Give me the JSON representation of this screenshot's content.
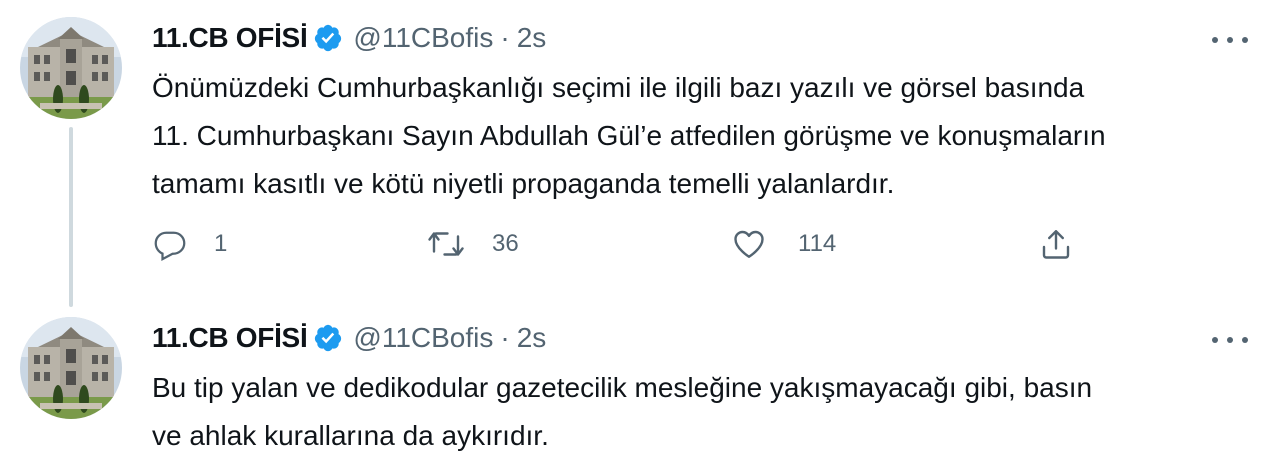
{
  "colors": {
    "text_primary": "#0f1419",
    "text_secondary": "#536471",
    "verified_blue": "#1d9bf0",
    "thread_line": "#cfd9de"
  },
  "tweets": [
    {
      "author": {
        "display_name": "11.CB OFİSİ",
        "handle": "@11CBofis",
        "separator": "·",
        "time": "2s",
        "verified_icon": "verified-badge-icon",
        "avatar_icon": "building-photo-avatar"
      },
      "text_lines": [
        "Önümüzdeki Cumhurbaşkanlığı seçimi ile ilgili bazı yazılı ve görsel basında",
        "11. Cumhurbaşkanı Sayın Abdullah Gül’e atfedilen görüşme ve konuşmaların",
        "tamamı kasıtlı ve kötü niyetli propaganda temelli yalanlardır."
      ],
      "actions": {
        "reply": {
          "icon": "reply-icon",
          "count": "1"
        },
        "retweet": {
          "icon": "retweet-icon",
          "count": "36"
        },
        "like": {
          "icon": "heart-icon",
          "count": "114"
        },
        "share": {
          "icon": "share-icon"
        }
      },
      "more_icon": "more-options-icon"
    },
    {
      "author": {
        "display_name": "11.CB OFİSİ",
        "handle": "@11CBofis",
        "separator": "·",
        "time": "2s",
        "verified_icon": "verified-badge-icon",
        "avatar_icon": "building-photo-avatar"
      },
      "text_lines": [
        "Bu tip yalan ve dedikodular gazetecilik mesleğine yakışmayacağı gibi, basın",
        "ve ahlak kurallarına da aykırıdır."
      ],
      "more_icon": "more-options-icon"
    }
  ]
}
